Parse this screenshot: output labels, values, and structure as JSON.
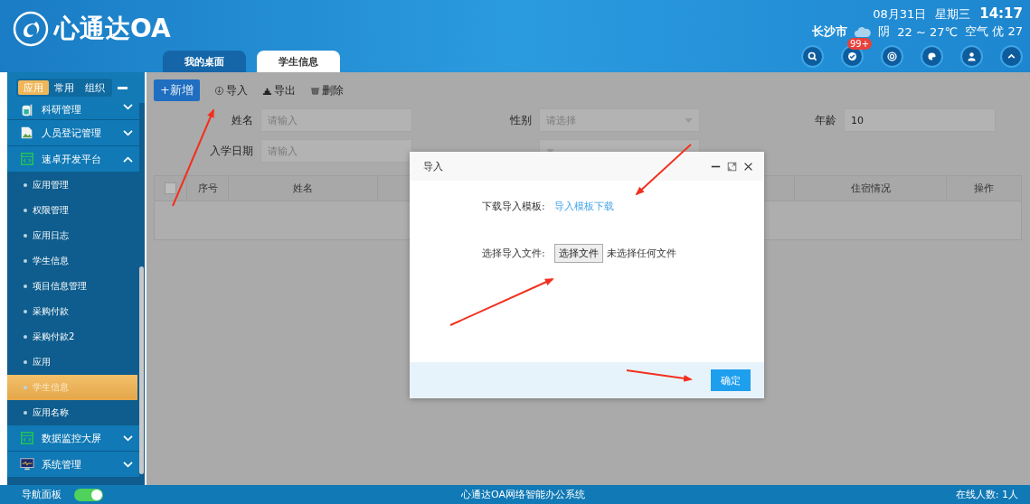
{
  "header": {
    "logo_text": "心通达OA",
    "date": "08月31日",
    "weekday": "星期三",
    "time": "14:17",
    "city": "长沙市",
    "weather": "阴",
    "temperature": "22 ~ 27℃",
    "air_quality": "空气 优 27",
    "notification_badge": "99+"
  },
  "tabs": [
    {
      "label": "我的桌面",
      "selected": false
    },
    {
      "label": "学生信息",
      "selected": true
    }
  ],
  "sidebar": {
    "switch_tabs": [
      {
        "label": "应用",
        "selected": true
      },
      {
        "label": "常用",
        "selected": false
      },
      {
        "label": "组织",
        "selected": false
      }
    ],
    "groups": [
      {
        "label": "科研管理",
        "expanded": false
      },
      {
        "label": "人员登记管理",
        "expanded": false
      },
      {
        "label": "速卓开发平台",
        "expanded": true,
        "children": [
          {
            "label": "应用管理",
            "selected": false
          },
          {
            "label": "权限管理",
            "selected": false
          },
          {
            "label": "应用日志",
            "selected": false
          },
          {
            "label": "学生信息",
            "selected": false
          },
          {
            "label": "项目信息管理",
            "selected": false
          },
          {
            "label": "采购付款",
            "selected": false
          },
          {
            "label": "采购付款2",
            "selected": false
          },
          {
            "label": "应用",
            "selected": false
          },
          {
            "label": "学生信息",
            "selected": true
          },
          {
            "label": "应用名称",
            "selected": false
          }
        ]
      },
      {
        "label": "数据监控大屏",
        "expanded": false
      },
      {
        "label": "系统管理",
        "expanded": false
      }
    ]
  },
  "toolbar": [
    {
      "label": "+新增",
      "kind": "primary"
    },
    {
      "label": "导入",
      "kind": "plain"
    },
    {
      "label": "导出",
      "kind": "plain"
    },
    {
      "label": "删除",
      "kind": "plain"
    }
  ],
  "form": [
    {
      "label": "姓名",
      "placeholder": "请输入",
      "kind": "input"
    },
    {
      "label": "性别",
      "placeholder": "请选择",
      "kind": "select"
    },
    {
      "label": "年龄",
      "value": "10",
      "kind": "input"
    },
    {
      "label": "入学日期",
      "placeholder": "请输入",
      "kind": "input"
    },
    {
      "kind": "select"
    }
  ],
  "table": {
    "select_all_checked": false,
    "columns": [
      "序号",
      "姓名",
      "住宿情况",
      "操作"
    ]
  },
  "dialog": {
    "title": "导入",
    "download_label": "下载导入模板:",
    "download_link": "导入模板下载",
    "file_label": "选择导入文件:",
    "file_button": "选择文件",
    "file_status": "未选择任何文件",
    "confirm": "确定"
  },
  "footer": {
    "nav_panel_label": "导航面板",
    "nav_panel_on": true,
    "title": "心通达OA网络智能办公系统",
    "online": "在线人数: 1人"
  }
}
